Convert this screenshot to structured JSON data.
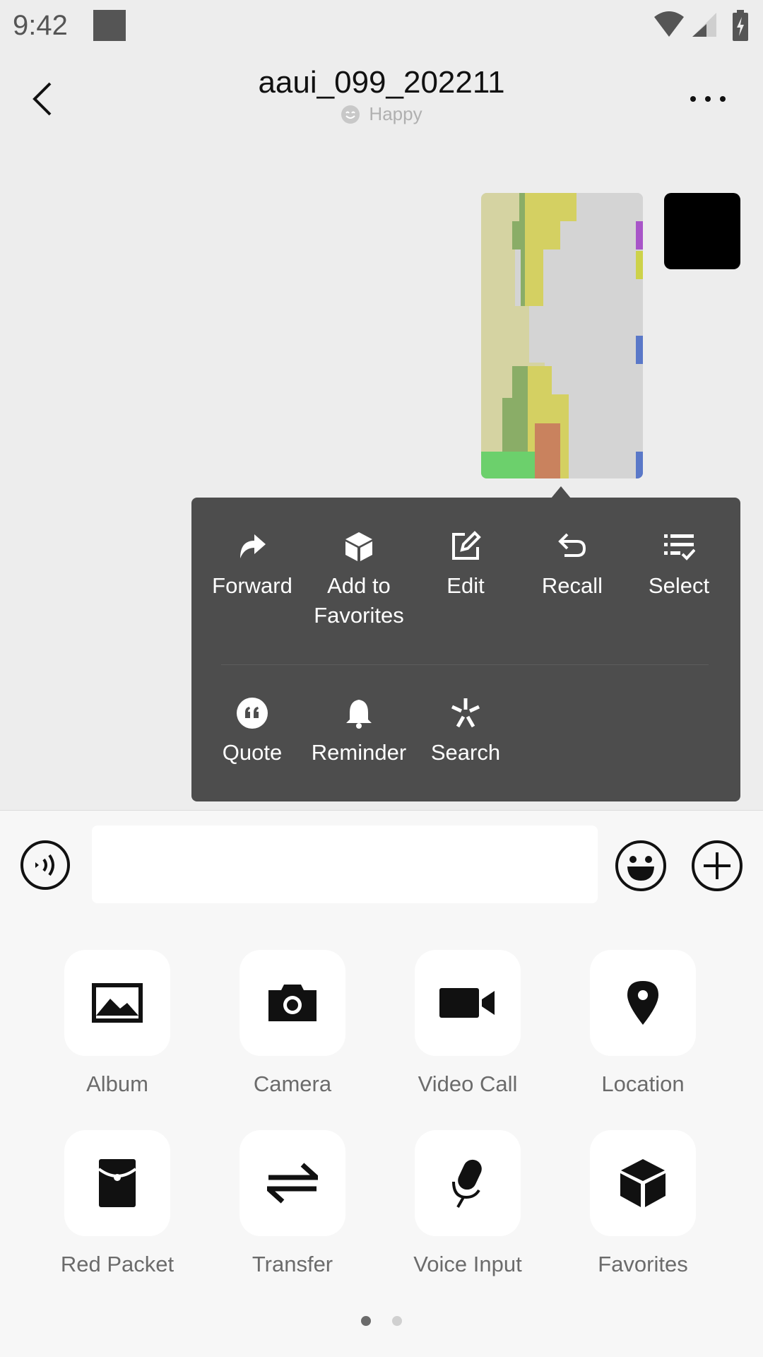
{
  "status_bar": {
    "time": "9:42"
  },
  "header": {
    "title": "aaui_099_202211",
    "status": "Happy"
  },
  "context_menu": {
    "row1": [
      {
        "label": "Forward",
        "icon": "forward-icon"
      },
      {
        "label": "Add to\nFavorites",
        "icon": "cube-icon"
      },
      {
        "label": "Edit",
        "icon": "edit-icon"
      },
      {
        "label": "Recall",
        "icon": "undo-icon"
      },
      {
        "label": "Select",
        "icon": "multi-select-icon"
      }
    ],
    "row2": [
      {
        "label": "Quote",
        "icon": "quote-icon"
      },
      {
        "label": "Reminder",
        "icon": "bell-icon"
      },
      {
        "label": "Search",
        "icon": "sparkle-search-icon"
      }
    ]
  },
  "input": {
    "value": "",
    "placeholder": ""
  },
  "panel": {
    "tools": [
      {
        "label": "Album",
        "icon": "album-icon"
      },
      {
        "label": "Camera",
        "icon": "camera-icon"
      },
      {
        "label": "Video Call",
        "icon": "video-icon"
      },
      {
        "label": "Location",
        "icon": "location-pin-icon"
      },
      {
        "label": "Red Packet",
        "icon": "red-packet-icon"
      },
      {
        "label": "Transfer",
        "icon": "transfer-icon"
      },
      {
        "label": "Voice Input",
        "icon": "microphone-icon"
      },
      {
        "label": "Favorites",
        "icon": "cube-icon"
      }
    ],
    "pages": 2,
    "current_page": 1
  },
  "colors": {
    "menu_bg": "#4d4d4d",
    "panel_bg": "#f7f7f7",
    "chat_bg": "#ededed"
  }
}
